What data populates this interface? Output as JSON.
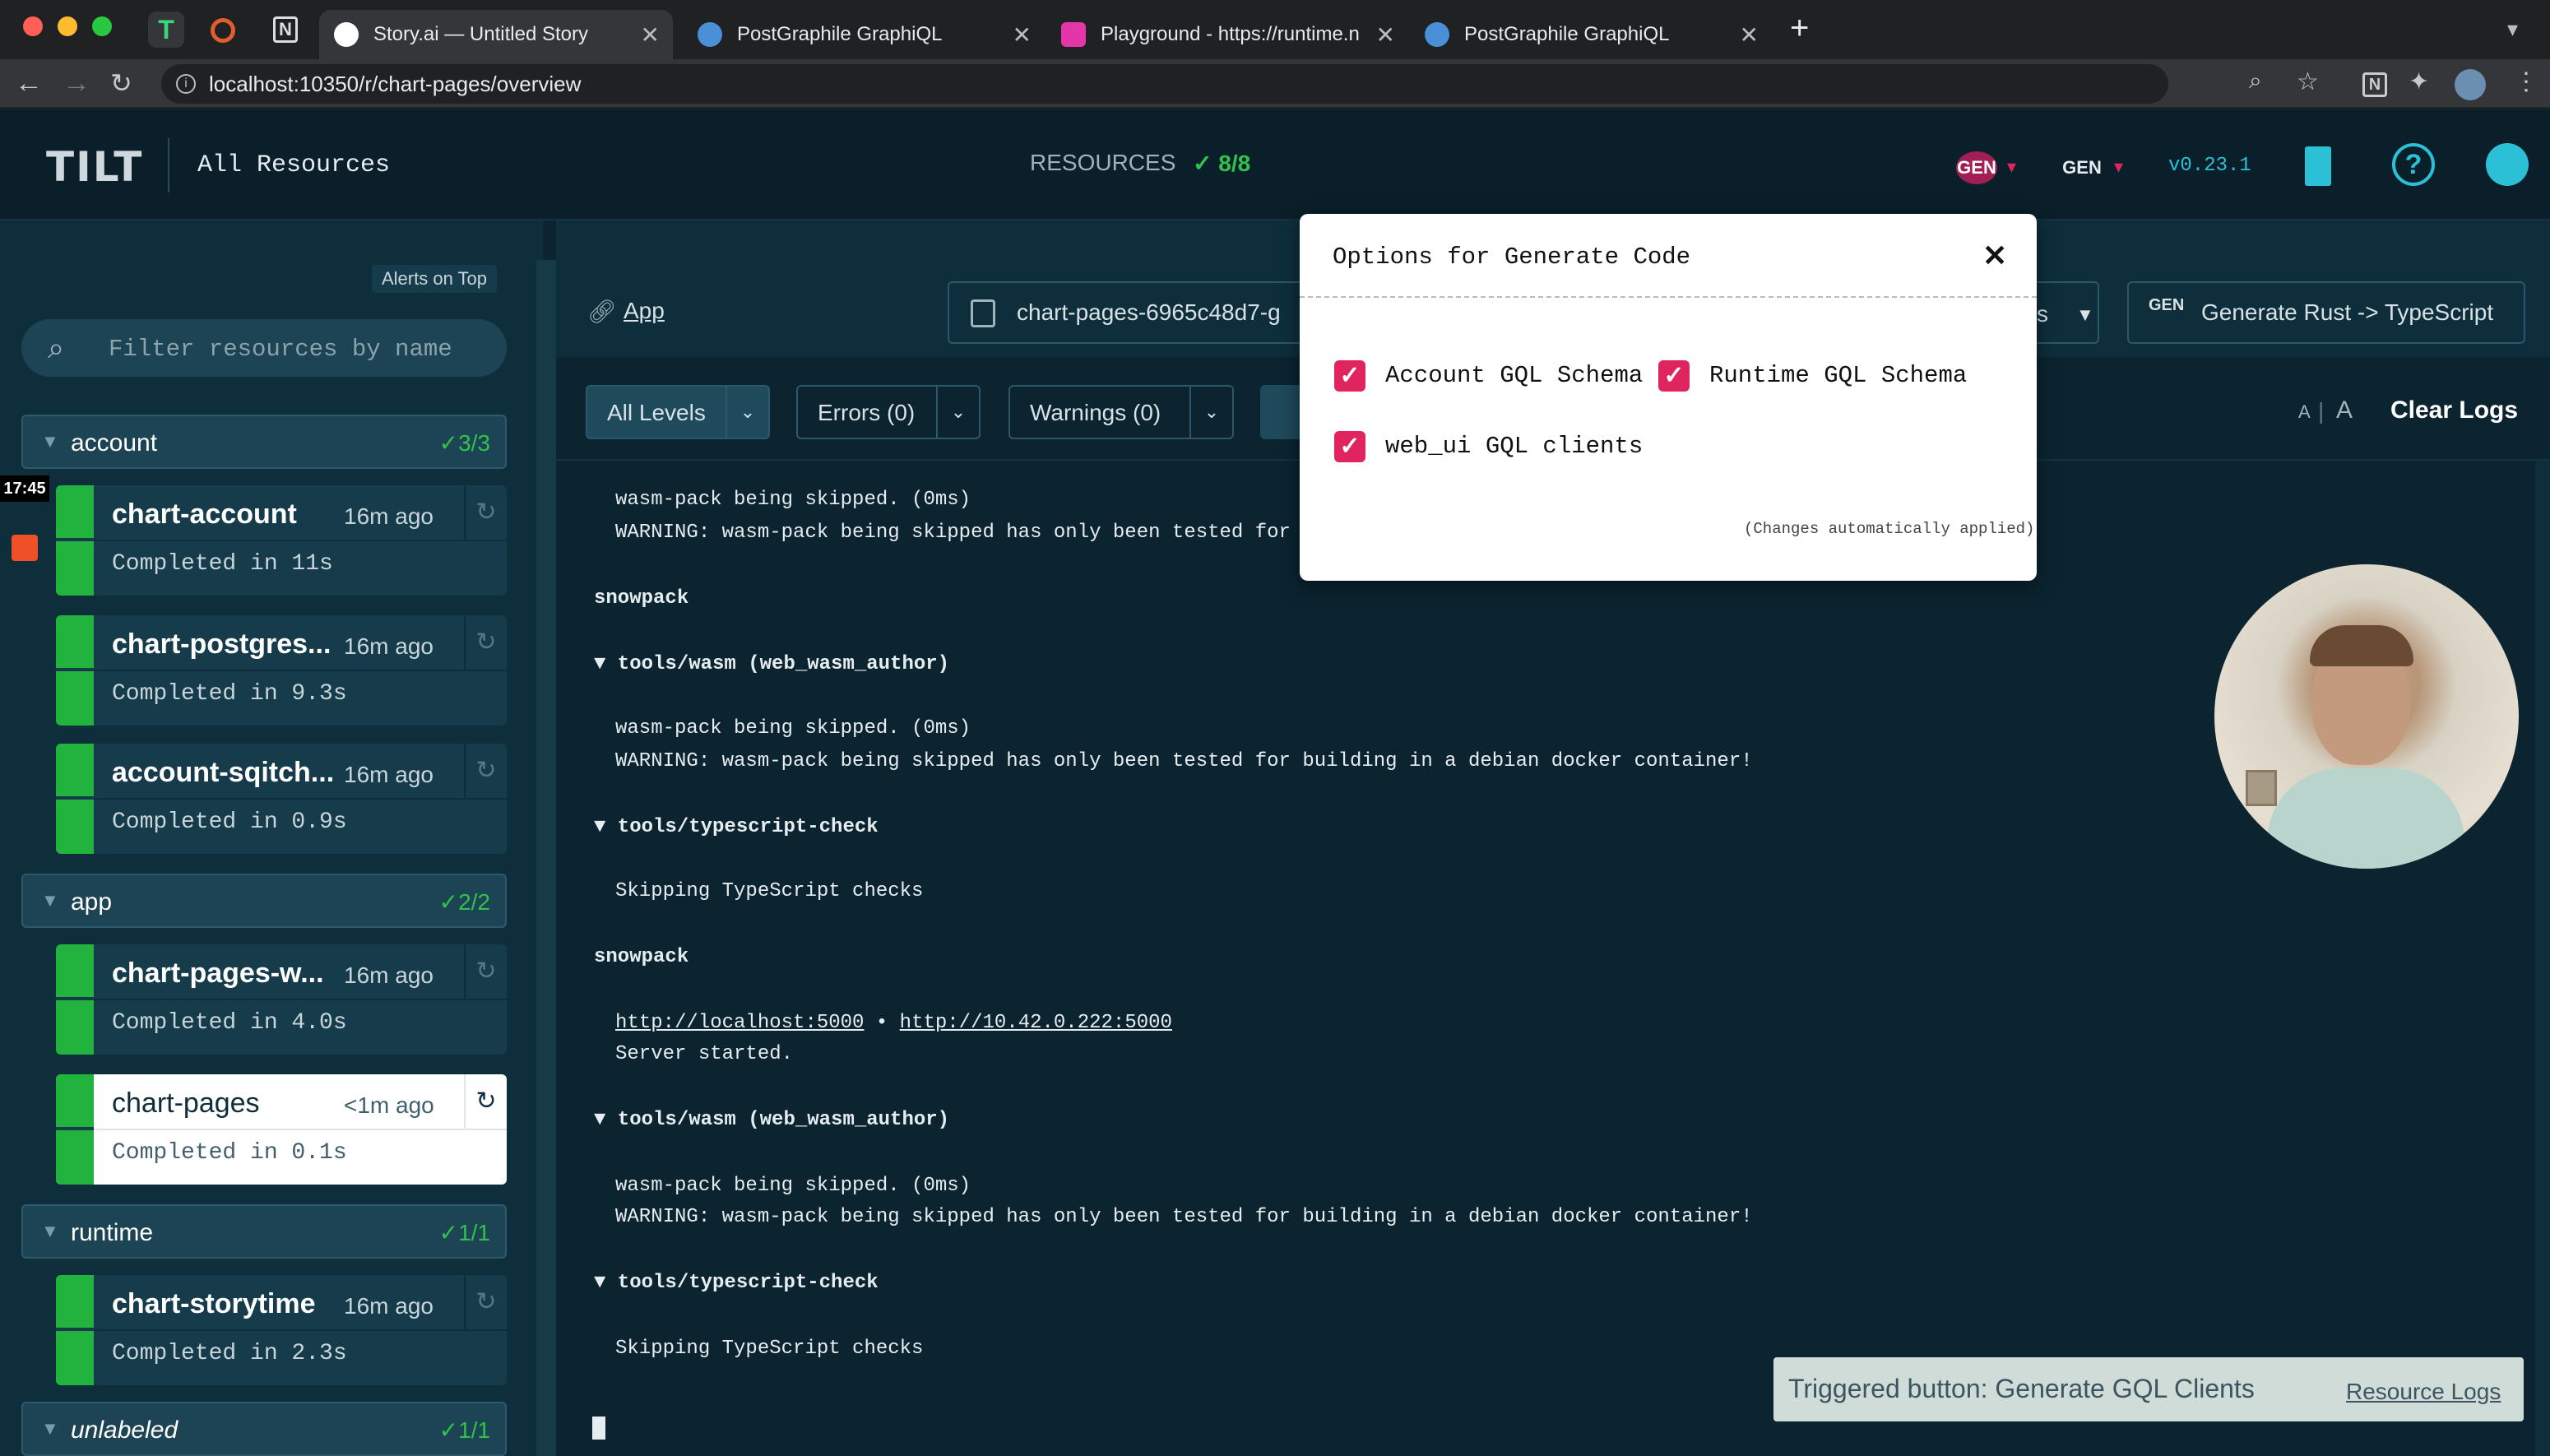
{
  "browser": {
    "tabs": [
      {
        "label": "Story.ai — Untitled Story"
      },
      {
        "label": "PostGraphile GraphiQL"
      },
      {
        "label": "Playground - https://runtime.n"
      },
      {
        "label": "PostGraphile GraphiQL"
      }
    ],
    "new_tab": "+",
    "url": "localhost:10350/r/chart-pages/overview"
  },
  "header": {
    "logo": "TILT",
    "all_resources": "All Resources",
    "resources_label": "RESOURCES",
    "resources_count": "✓ 8/8",
    "gen1": "GEN",
    "gen2": "GEN",
    "version": "v0.23.1"
  },
  "sidebar": {
    "alerts_on_top": "Alerts on Top",
    "filter_placeholder": "Filter resources by name",
    "clock": "17:45",
    "groups": [
      {
        "label": "account",
        "count": "✓3/3"
      },
      {
        "label": "app",
        "count": "✓2/2"
      },
      {
        "label": "runtime",
        "count": "✓1/1"
      },
      {
        "label": "unlabeled",
        "count": "✓1/1"
      }
    ],
    "resources": [
      {
        "name": "chart-account",
        "ago": "16m ago",
        "status": "Completed in 11s"
      },
      {
        "name": "chart-postgres...",
        "ago": "16m ago",
        "status": "Completed in 9.3s"
      },
      {
        "name": "account-sqitch...",
        "ago": "16m ago",
        "status": "Completed in 0.9s"
      },
      {
        "name": "chart-pages-w...",
        "ago": "16m ago",
        "status": "Completed in 4.0s"
      },
      {
        "name": "chart-pages",
        "ago": "<1m ago",
        "status": "Completed in 0.1s"
      },
      {
        "name": "chart-storytime",
        "ago": "16m ago",
        "status": "Completed in 2.3s"
      }
    ]
  },
  "main": {
    "app_link": "App",
    "pod": "chart-pages-6965c48d7-g",
    "s_label": "s",
    "generate_button": "Generate Rust -> TypeScript",
    "filters": {
      "all_levels": "All Levels",
      "errors": "Errors (0)",
      "warnings": "Warnings (0)"
    },
    "font_small": "A",
    "font_sep": "|",
    "font_large": "A",
    "clear_logs": "Clear Logs",
    "log": {
      "l1": "wasm-pack being skipped. (0ms)",
      "l2": "WARNING: wasm-pack being skipped has only been tested for buil",
      "l3": "snowpack",
      "l4": "▼ tools/wasm (web_wasm_author)",
      "l5": "wasm-pack being skipped. (0ms)",
      "l6": "WARNING: wasm-pack being skipped has only been tested for building in a debian docker container!",
      "l7": "▼ tools/typescript-check",
      "l8": "Skipping TypeScript checks",
      "l9": "snowpack",
      "l10a": "http://localhost:5000",
      "l10b": " • ",
      "l10c": "http://10.42.0.222:5000",
      "l11": "Server started.",
      "l12": "▼ tools/wasm (web_wasm_author)",
      "l13": "wasm-pack being skipped. (0ms)",
      "l14": "WARNING: wasm-pack being skipped has only been tested for building in a debian docker container!",
      "l15": "▼ tools/typescript-check",
      "l16": "Skipping TypeScript checks"
    },
    "toast": "Triggered button: Generate GQL Clients",
    "toast_link": "Resource Logs"
  },
  "modal": {
    "title": "Options for Generate Code",
    "options": [
      {
        "label": "Account GQL Schema",
        "checked": true
      },
      {
        "label": "Runtime GQL Schema",
        "checked": true
      },
      {
        "label": "web_ui GQL clients",
        "checked": true
      }
    ],
    "note": "(Changes automatically applied)"
  },
  "colors": {
    "accent": "#e0245e",
    "ok": "#22b23e",
    "bg": "#0b2430"
  }
}
